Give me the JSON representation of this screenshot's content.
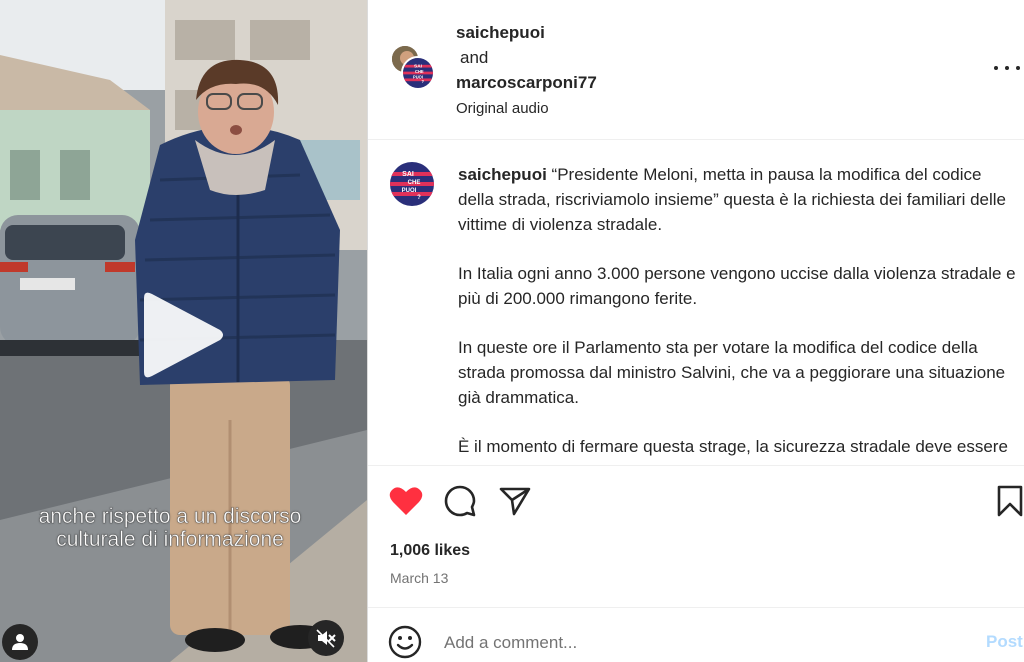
{
  "video": {
    "subtitle_line1": "anche rispetto a un discorso",
    "subtitle_line2": "culturale di informazione",
    "play_icon": "play-icon",
    "muted_icon": "speaker-muted-icon",
    "user_icon": "person-icon"
  },
  "header": {
    "user1": "saichepuoi",
    "connector": "and",
    "user2": "marcoscarponi77",
    "audio_label": "Original audio",
    "more_icon": "more-dots-icon"
  },
  "brand_logo": {
    "line1": "SAI",
    "line2": "CHE",
    "line3": "PUOI",
    "line4": "?"
  },
  "post": {
    "username": "saichepuoi",
    "paragraph1": "“Presidente Meloni, metta in pausa la modifica del codice della strada, riscriviamolo insieme” questa è la richiesta dei familiari delle vittime di violenza stradale.",
    "paragraph2": "In Italia ogni anno 3.000 persone vengono uccise dalla violenza stradale e più di 200.000 rimangono ferite.",
    "paragraph3": "In queste ore il Parlamento sta per votare la modifica del codice della strada promossa dal ministro Salvini, che va a peggiorare una situazione già drammatica.",
    "paragraph4": "È il momento di fermare questa strage, la sicurezza stradale deve essere una priorità."
  },
  "actions": {
    "liked": true,
    "like_color": "#ff3040",
    "likes_text": "1,006 likes",
    "date_text": "March 13"
  },
  "comment": {
    "placeholder": "Add a comment...",
    "post_label": "Post",
    "post_color": "#b3dbff"
  }
}
